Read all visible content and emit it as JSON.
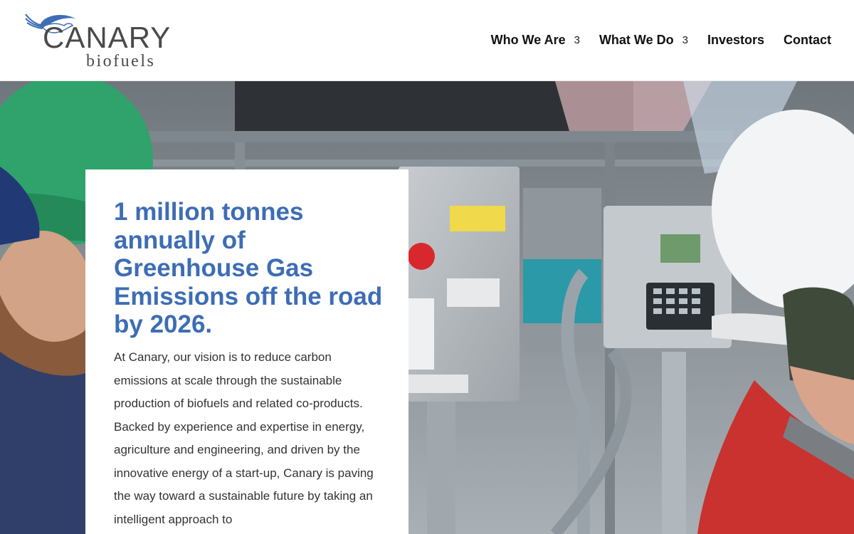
{
  "brand": {
    "name": "CANARY",
    "tagline": "biofuels",
    "logo_icon": "canary-bird-icon",
    "colors": {
      "primary_blue": "#3d6db5",
      "logo_gray": "#4a4a4a"
    }
  },
  "nav": {
    "items": [
      {
        "label": "Who We Are",
        "has_dropdown": true,
        "dropdown_icon": "chevron-down-icon"
      },
      {
        "label": "What We Do",
        "has_dropdown": true,
        "dropdown_icon": "chevron-down-icon"
      },
      {
        "label": "Investors",
        "has_dropdown": false
      },
      {
        "label": "Contact",
        "has_dropdown": false
      }
    ],
    "chevron_glyph": "3"
  },
  "hero": {
    "image": "workers-at-biofuel-equipment-photo",
    "headline": "1 million tonnes annually of Greenhouse Gas Emissions off the road by 2026.",
    "body": "At Canary, our vision is to reduce carbon emissions at scale through the sustainable production of biofuels and related co-products. Backed by experience and expertise in energy, agriculture and engineering, and driven by the innovative energy of a start-up, Canary is paving the way toward a sustainable future by taking an intelligent approach to"
  }
}
